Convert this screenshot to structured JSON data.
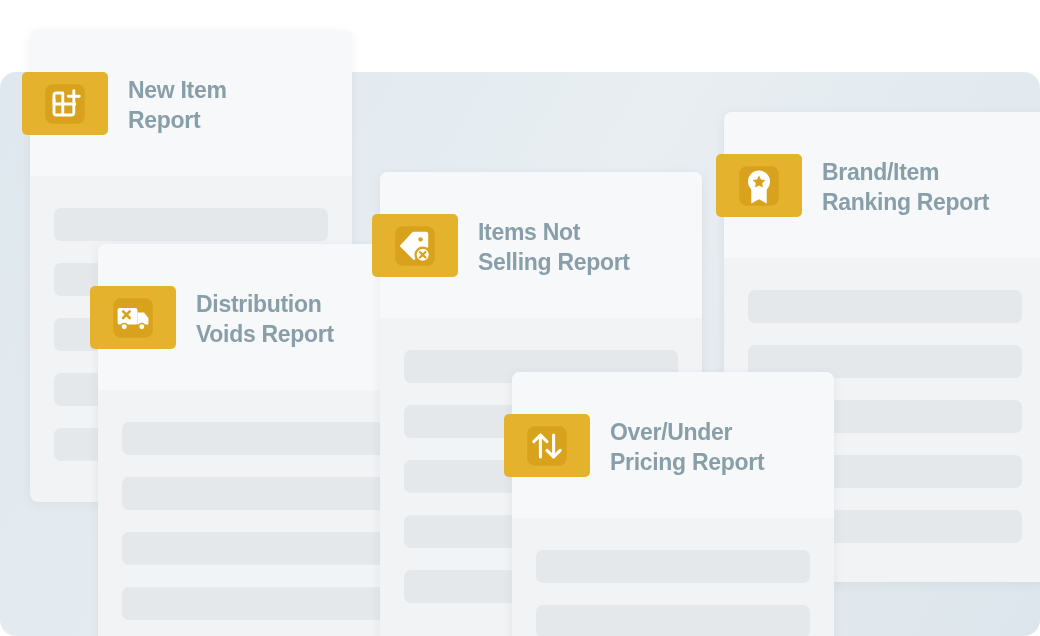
{
  "reports": [
    {
      "title_lines": [
        "New Item",
        "Report"
      ],
      "kind": "grid-plus"
    },
    {
      "title_lines": [
        "Distribution",
        "Voids Report"
      ],
      "kind": "truck"
    },
    {
      "title_lines": [
        "Items Not",
        "Selling Report"
      ],
      "kind": "tag"
    },
    {
      "title_lines": [
        "Brand/Item",
        "Ranking Report"
      ],
      "kind": "award"
    },
    {
      "title_lines": [
        "Over/Under",
        "Pricing Report"
      ],
      "kind": "arrows"
    }
  ]
}
